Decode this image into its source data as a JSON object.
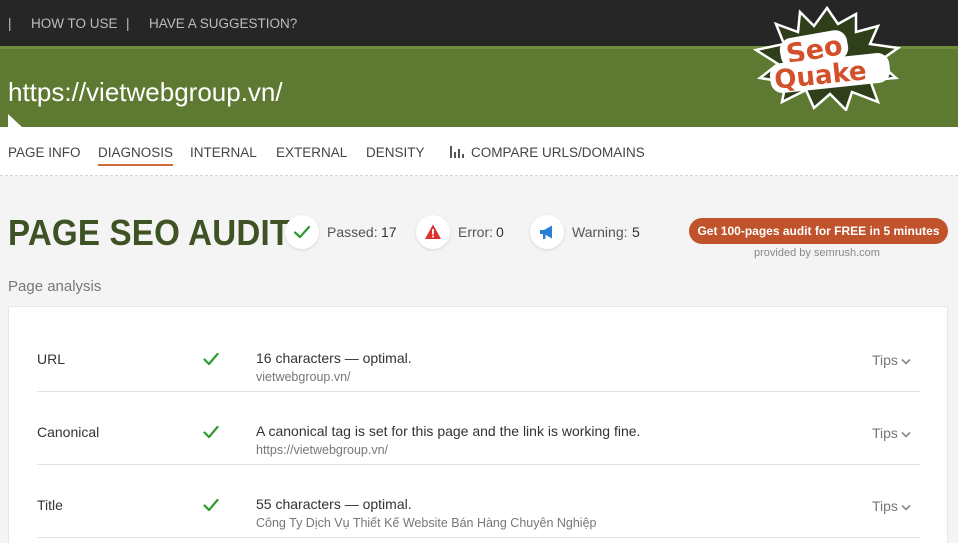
{
  "topnav": {
    "sep1": "|",
    "how_to_use": "HOW TO USE",
    "sep2": "|",
    "suggestion": "HAVE A SUGGESTION?"
  },
  "header": {
    "url": "https://vietwebgroup.vn/",
    "logo_line1": "Seo",
    "logo_line2": "Quake"
  },
  "tabs": [
    {
      "label": "PAGE INFO",
      "active": false
    },
    {
      "label": "DIAGNOSIS",
      "active": true
    },
    {
      "label": "INTERNAL",
      "active": false
    },
    {
      "label": "EXTERNAL",
      "active": false
    },
    {
      "label": "DENSITY",
      "active": false
    },
    {
      "label": "COMPARE URLS/DOMAINS",
      "active": false,
      "icon": "bar-chart-icon"
    }
  ],
  "audit": {
    "title": "PAGE SEO AUDIT",
    "passed_label": "Passed:",
    "passed_value": "17",
    "error_label": "Error:",
    "error_value": "0",
    "warning_label": "Warning:",
    "warning_value": "5",
    "cta_label": "Get 100-pages audit for FREE in 5 minutes",
    "provided_by": "provided by  semrush.com"
  },
  "analysis": {
    "section_label": "Page analysis",
    "rows": [
      {
        "name": "URL",
        "status": "passed",
        "message": "16 characters — optimal.",
        "detail": "vietwebgroup.vn/",
        "tips": "Tips"
      },
      {
        "name": "Canonical",
        "status": "passed",
        "message": "A canonical tag is set for this page and the link is working fine.",
        "detail": "https://vietwebgroup.vn/",
        "tips": "Tips"
      },
      {
        "name": "Title",
        "status": "passed",
        "message": "55 characters — optimal.",
        "detail": "Công Ty Dịch Vụ Thiết Kế Website Bán Hàng Chuyên Nghiệp",
        "tips": "Tips"
      }
    ]
  },
  "colors": {
    "topnav_bg": "#262626",
    "header_green": "#5e7a32",
    "title_green": "#3e5224",
    "cta_orange": "#c0532c",
    "check_green": "#2e9b2e",
    "error_red": "#d9312b",
    "warning_blue": "#2a7fd4"
  }
}
